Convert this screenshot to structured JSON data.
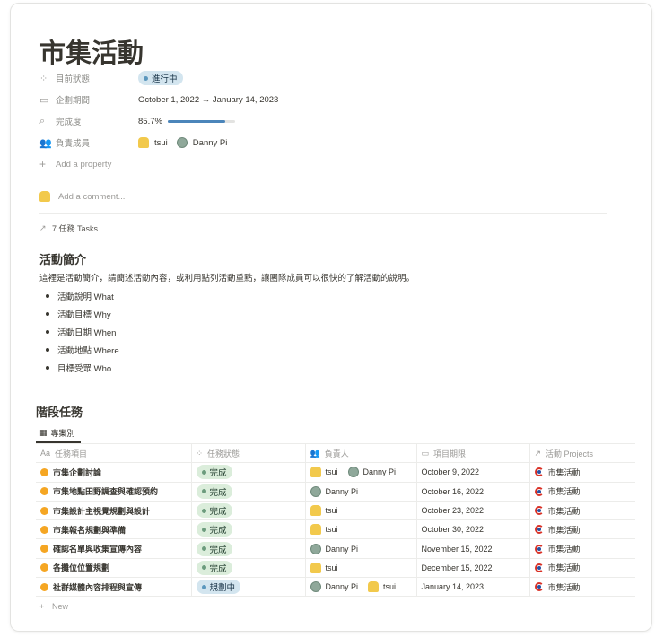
{
  "page": {
    "title": "市集活動"
  },
  "properties": [
    {
      "label": "目前狀態",
      "icon": "status-icon",
      "value": "進行中"
    },
    {
      "label": "企劃期間",
      "icon": "calendar-icon",
      "value": "October 1, 2022 → January 14, 2023"
    },
    {
      "label": "完成度",
      "icon": "search-icon",
      "value": "85.7%",
      "progress": 0.857
    },
    {
      "label": "負責成員",
      "icon": "people-icon",
      "members": [
        "tsui",
        "Danny Pi"
      ]
    }
  ],
  "add_property": "Add a property",
  "comment_placeholder": "Add a comment...",
  "tasks_link": "7 任務 Tasks",
  "intro": {
    "heading": "活動簡介",
    "text": "這裡是活動簡介，請簡述活動內容，或利用點列活動重點，讓團隊成員可以很快的了解活動的說明。",
    "bullets": [
      "活動說明 What",
      "活動目標 Why",
      "活動日期 When",
      "活動地點 Where",
      "目標受眾 Who"
    ]
  },
  "tasks": {
    "heading": "階段任務",
    "view_tab": "專案別",
    "columns": [
      "任務項目",
      "任務狀態",
      "負責人",
      "項目期限",
      "活動 Projects"
    ],
    "rows": [
      {
        "name": "市集企劃討論",
        "status": "完成",
        "people": [
          "tsui",
          "Danny Pi"
        ],
        "date": "October 9, 2022",
        "project": "市集活動"
      },
      {
        "name": "市集地點田野調查與確認預約",
        "status": "完成",
        "people": [
          "Danny Pi"
        ],
        "date": "October 16, 2022",
        "project": "市集活動"
      },
      {
        "name": "市集設計主視覺規劃與設計",
        "status": "完成",
        "people": [
          "tsui"
        ],
        "date": "October 23, 2022",
        "project": "市集活動"
      },
      {
        "name": "市集報名規劃與準備",
        "status": "完成",
        "people": [
          "tsui"
        ],
        "date": "October 30, 2022",
        "project": "市集活動"
      },
      {
        "name": "確認名單與收集宣傳內容",
        "status": "完成",
        "people": [
          "Danny Pi"
        ],
        "date": "November 15, 2022",
        "project": "市集活動"
      },
      {
        "name": "各攤位位置規劃",
        "status": "完成",
        "people": [
          "tsui"
        ],
        "date": "December 15, 2022",
        "project": "市集活動"
      },
      {
        "name": "社群媒體內容排程與宣傳",
        "status": "規劃中",
        "people": [
          "Danny Pi",
          "tsui"
        ],
        "date": "January 14, 2023",
        "project": "市集活動"
      }
    ],
    "new_label": "New"
  }
}
